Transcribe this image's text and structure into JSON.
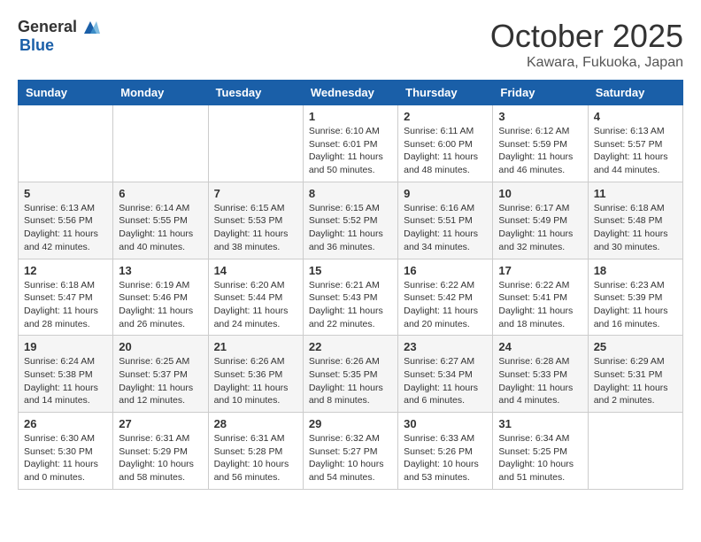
{
  "header": {
    "logo_general": "General",
    "logo_blue": "Blue",
    "month": "October 2025",
    "location": "Kawara, Fukuoka, Japan"
  },
  "weekdays": [
    "Sunday",
    "Monday",
    "Tuesday",
    "Wednesday",
    "Thursday",
    "Friday",
    "Saturday"
  ],
  "weeks": [
    [
      {
        "day": "",
        "text": ""
      },
      {
        "day": "",
        "text": ""
      },
      {
        "day": "",
        "text": ""
      },
      {
        "day": "1",
        "text": "Sunrise: 6:10 AM\nSunset: 6:01 PM\nDaylight: 11 hours\nand 50 minutes."
      },
      {
        "day": "2",
        "text": "Sunrise: 6:11 AM\nSunset: 6:00 PM\nDaylight: 11 hours\nand 48 minutes."
      },
      {
        "day": "3",
        "text": "Sunrise: 6:12 AM\nSunset: 5:59 PM\nDaylight: 11 hours\nand 46 minutes."
      },
      {
        "day": "4",
        "text": "Sunrise: 6:13 AM\nSunset: 5:57 PM\nDaylight: 11 hours\nand 44 minutes."
      }
    ],
    [
      {
        "day": "5",
        "text": "Sunrise: 6:13 AM\nSunset: 5:56 PM\nDaylight: 11 hours\nand 42 minutes."
      },
      {
        "day": "6",
        "text": "Sunrise: 6:14 AM\nSunset: 5:55 PM\nDaylight: 11 hours\nand 40 minutes."
      },
      {
        "day": "7",
        "text": "Sunrise: 6:15 AM\nSunset: 5:53 PM\nDaylight: 11 hours\nand 38 minutes."
      },
      {
        "day": "8",
        "text": "Sunrise: 6:15 AM\nSunset: 5:52 PM\nDaylight: 11 hours\nand 36 minutes."
      },
      {
        "day": "9",
        "text": "Sunrise: 6:16 AM\nSunset: 5:51 PM\nDaylight: 11 hours\nand 34 minutes."
      },
      {
        "day": "10",
        "text": "Sunrise: 6:17 AM\nSunset: 5:49 PM\nDaylight: 11 hours\nand 32 minutes."
      },
      {
        "day": "11",
        "text": "Sunrise: 6:18 AM\nSunset: 5:48 PM\nDaylight: 11 hours\nand 30 minutes."
      }
    ],
    [
      {
        "day": "12",
        "text": "Sunrise: 6:18 AM\nSunset: 5:47 PM\nDaylight: 11 hours\nand 28 minutes."
      },
      {
        "day": "13",
        "text": "Sunrise: 6:19 AM\nSunset: 5:46 PM\nDaylight: 11 hours\nand 26 minutes."
      },
      {
        "day": "14",
        "text": "Sunrise: 6:20 AM\nSunset: 5:44 PM\nDaylight: 11 hours\nand 24 minutes."
      },
      {
        "day": "15",
        "text": "Sunrise: 6:21 AM\nSunset: 5:43 PM\nDaylight: 11 hours\nand 22 minutes."
      },
      {
        "day": "16",
        "text": "Sunrise: 6:22 AM\nSunset: 5:42 PM\nDaylight: 11 hours\nand 20 minutes."
      },
      {
        "day": "17",
        "text": "Sunrise: 6:22 AM\nSunset: 5:41 PM\nDaylight: 11 hours\nand 18 minutes."
      },
      {
        "day": "18",
        "text": "Sunrise: 6:23 AM\nSunset: 5:39 PM\nDaylight: 11 hours\nand 16 minutes."
      }
    ],
    [
      {
        "day": "19",
        "text": "Sunrise: 6:24 AM\nSunset: 5:38 PM\nDaylight: 11 hours\nand 14 minutes."
      },
      {
        "day": "20",
        "text": "Sunrise: 6:25 AM\nSunset: 5:37 PM\nDaylight: 11 hours\nand 12 minutes."
      },
      {
        "day": "21",
        "text": "Sunrise: 6:26 AM\nSunset: 5:36 PM\nDaylight: 11 hours\nand 10 minutes."
      },
      {
        "day": "22",
        "text": "Sunrise: 6:26 AM\nSunset: 5:35 PM\nDaylight: 11 hours\nand 8 minutes."
      },
      {
        "day": "23",
        "text": "Sunrise: 6:27 AM\nSunset: 5:34 PM\nDaylight: 11 hours\nand 6 minutes."
      },
      {
        "day": "24",
        "text": "Sunrise: 6:28 AM\nSunset: 5:33 PM\nDaylight: 11 hours\nand 4 minutes."
      },
      {
        "day": "25",
        "text": "Sunrise: 6:29 AM\nSunset: 5:31 PM\nDaylight: 11 hours\nand 2 minutes."
      }
    ],
    [
      {
        "day": "26",
        "text": "Sunrise: 6:30 AM\nSunset: 5:30 PM\nDaylight: 11 hours\nand 0 minutes."
      },
      {
        "day": "27",
        "text": "Sunrise: 6:31 AM\nSunset: 5:29 PM\nDaylight: 10 hours\nand 58 minutes."
      },
      {
        "day": "28",
        "text": "Sunrise: 6:31 AM\nSunset: 5:28 PM\nDaylight: 10 hours\nand 56 minutes."
      },
      {
        "day": "29",
        "text": "Sunrise: 6:32 AM\nSunset: 5:27 PM\nDaylight: 10 hours\nand 54 minutes."
      },
      {
        "day": "30",
        "text": "Sunrise: 6:33 AM\nSunset: 5:26 PM\nDaylight: 10 hours\nand 53 minutes."
      },
      {
        "day": "31",
        "text": "Sunrise: 6:34 AM\nSunset: 5:25 PM\nDaylight: 10 hours\nand 51 minutes."
      },
      {
        "day": "",
        "text": ""
      }
    ]
  ]
}
